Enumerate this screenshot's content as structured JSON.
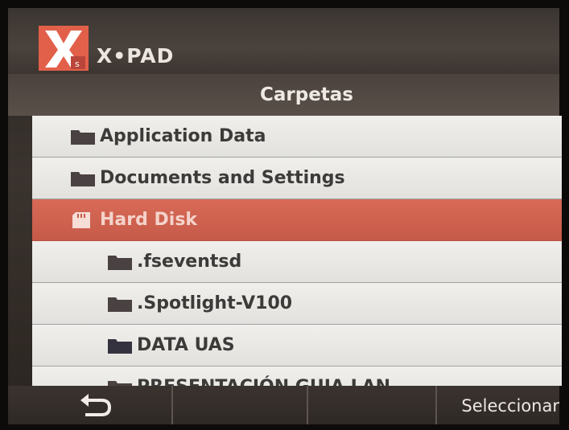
{
  "app": {
    "title": "X•PAD",
    "logo_icon": "x-pad-logo-icon",
    "logo_color": "#e2604a"
  },
  "header": {
    "title": "Carpetas"
  },
  "folders": [
    {
      "label": "Application Data",
      "icon": "folder-icon",
      "level": 0,
      "selected": false
    },
    {
      "label": "Documents and Settings",
      "icon": "folder-icon",
      "level": 0,
      "selected": false
    },
    {
      "label": "Hard Disk",
      "icon": "sd-card-icon",
      "level": 0,
      "selected": true
    },
    {
      "label": ".fseventsd",
      "icon": "folder-icon",
      "level": 1,
      "selected": false
    },
    {
      "label": ".Spotlight-V100",
      "icon": "folder-icon",
      "level": 1,
      "selected": false
    },
    {
      "label": "DATA UAS",
      "icon": "folder-icon",
      "level": 1,
      "selected": false
    },
    {
      "label": "PRESENTACIÓN GUIA LAN...",
      "icon": "folder-icon",
      "level": 1,
      "selected": false
    }
  ],
  "softkeys": {
    "back_icon": "back-arrow-icon",
    "select_label": "Seleccionar"
  },
  "colors": {
    "selected_row": "#d86a57",
    "list_background": "#e9e8e4",
    "bar_background": "#3a332f"
  }
}
